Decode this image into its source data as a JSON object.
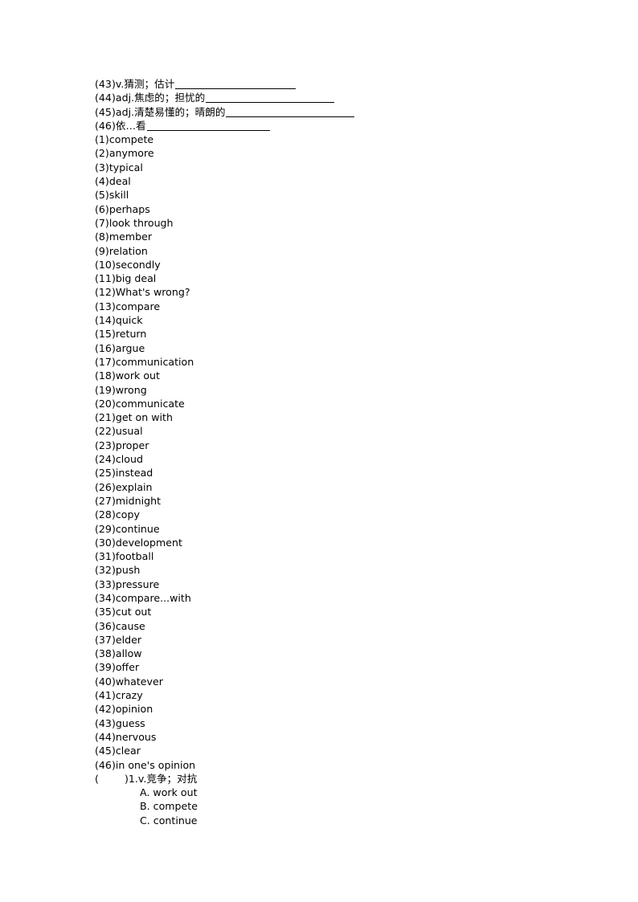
{
  "document": {
    "fill_in_blanks": [
      {
        "number": "(43)",
        "pos": "v.",
        "prompt": "猜测；估计",
        "blank_width": 150
      },
      {
        "number": "(44)",
        "pos": "adj.",
        "prompt": "焦虑的；担忧的",
        "blank_width": 160
      },
      {
        "number": "(45)",
        "pos": "adj.",
        "prompt": "清楚易懂的；晴朗的",
        "blank_width": 160
      },
      {
        "number": "(46)",
        "pos": "",
        "prompt": "依…看",
        "blank_width": 153
      }
    ],
    "word_list": [
      "(1)compete",
      "(2)anymore",
      "(3)typical",
      "(4)deal",
      "(5)skill",
      "(6)perhaps",
      "(7)look through",
      "(8)member",
      "(9)relation",
      "(10)secondly",
      "(11)big deal",
      "(12)What's wrong?",
      "(13)compare",
      "(14)quick",
      "(15)return",
      "(16)argue",
      "(17)communication",
      "(18)work out",
      "(19)wrong",
      "(20)communicate",
      "(21)get on with",
      "(22)usual",
      "(23)proper",
      "(24)cloud",
      "(25)instead",
      "(26)explain",
      "(27)midnight",
      "(28)copy",
      "(29)continue",
      "(30)development",
      "(31)football",
      "(32)push",
      "(33)pressure",
      "(34)compare...with",
      "(35)cut out",
      "(36)cause",
      "(37)elder",
      "(38)allow",
      "(39)offer",
      "(40)whatever",
      "(41)crazy",
      "(42)opinion",
      "(43)guess",
      "(44)nervous",
      "(45)clear",
      "(46)in one's opinion"
    ],
    "multiple_choice": {
      "stem": "(        )1.v.竞争；对抗",
      "options": [
        "A. work out",
        "B. compete",
        "C. continue"
      ]
    }
  }
}
